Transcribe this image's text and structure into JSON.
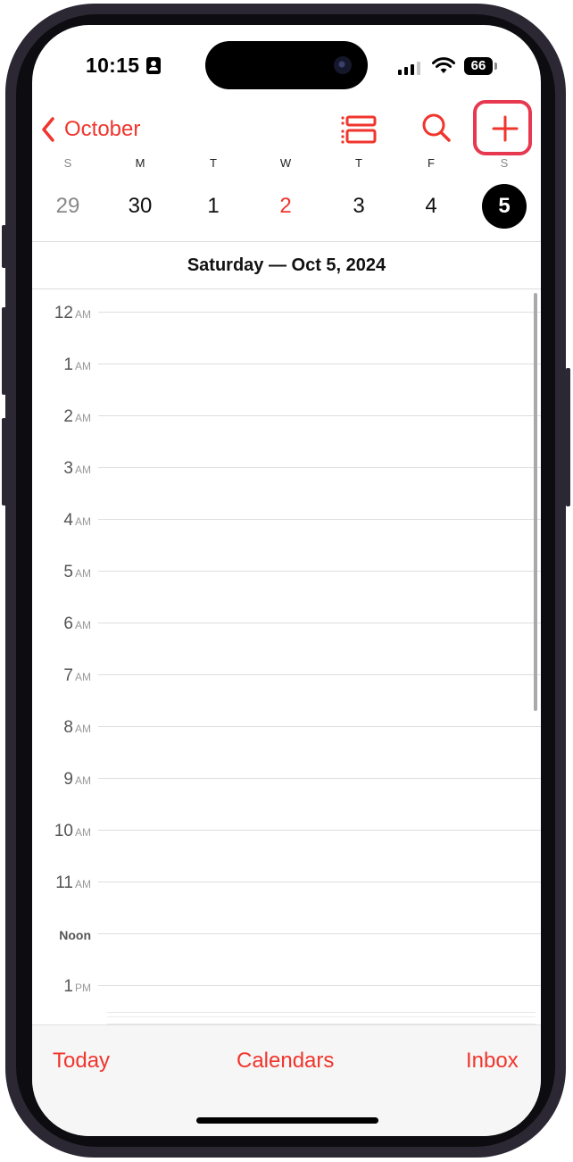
{
  "status_bar": {
    "time": "10:15",
    "battery": "66"
  },
  "nav": {
    "back_label": "October"
  },
  "week": {
    "days": [
      {
        "dow": "S",
        "num": "29"
      },
      {
        "dow": "M",
        "num": "30"
      },
      {
        "dow": "T",
        "num": "1"
      },
      {
        "dow": "W",
        "num": "2"
      },
      {
        "dow": "T",
        "num": "3"
      },
      {
        "dow": "F",
        "num": "4"
      },
      {
        "dow": "S",
        "num": "5"
      }
    ]
  },
  "date_header": "Saturday — Oct 5, 2024",
  "hours": [
    {
      "hour": "12",
      "ampm": "AM"
    },
    {
      "hour": "1",
      "ampm": "AM"
    },
    {
      "hour": "2",
      "ampm": "AM"
    },
    {
      "hour": "3",
      "ampm": "AM"
    },
    {
      "hour": "4",
      "ampm": "AM"
    },
    {
      "hour": "5",
      "ampm": "AM"
    },
    {
      "hour": "6",
      "ampm": "AM"
    },
    {
      "hour": "7",
      "ampm": "AM"
    },
    {
      "hour": "8",
      "ampm": "AM"
    },
    {
      "hour": "9",
      "ampm": "AM"
    },
    {
      "hour": "10",
      "ampm": "AM"
    },
    {
      "hour": "11",
      "ampm": "AM"
    },
    {
      "hour": "Noon",
      "ampm": ""
    },
    {
      "hour": "1",
      "ampm": "PM"
    }
  ],
  "toolbar": {
    "today": "Today",
    "calendars": "Calendars",
    "inbox": "Inbox"
  },
  "colors": {
    "accent": "#f0352d",
    "highlight": "#e63950"
  }
}
